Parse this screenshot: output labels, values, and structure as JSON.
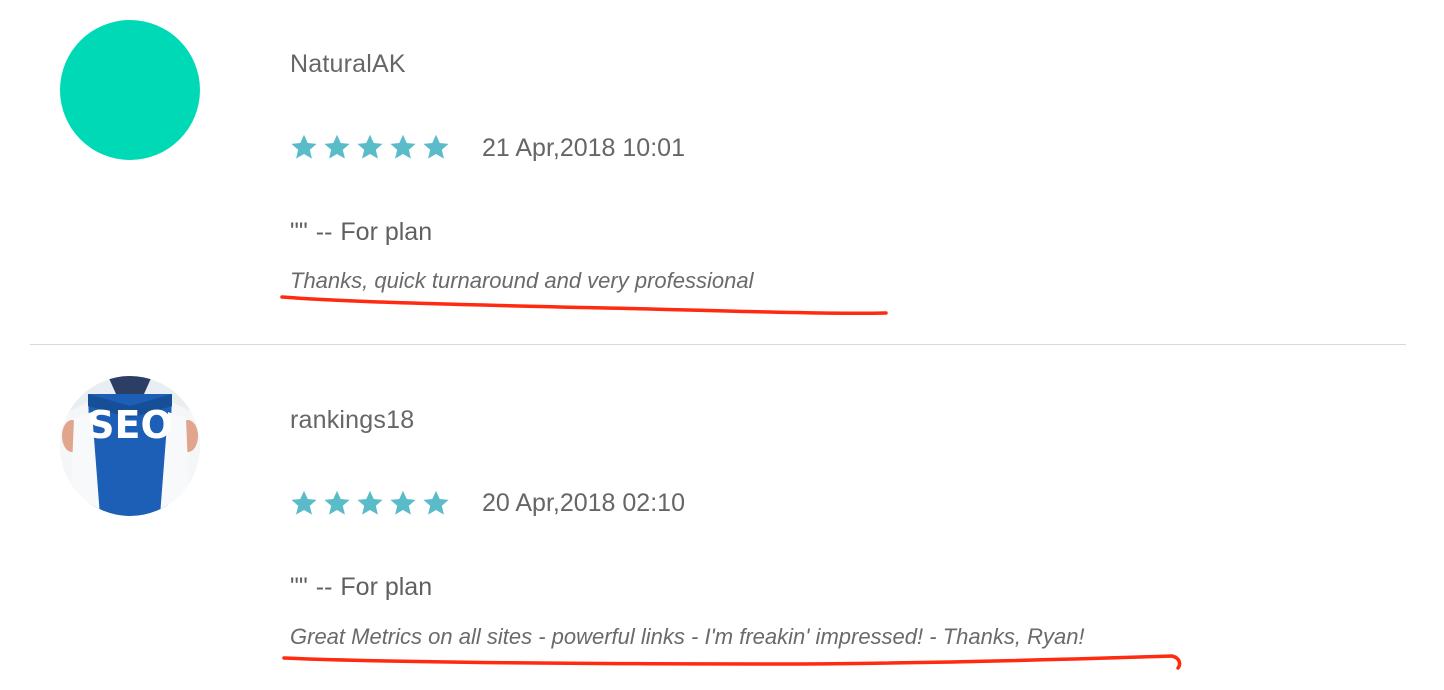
{
  "reviews": [
    {
      "username": "NaturalAK",
      "avatar": {
        "type": "solid",
        "color": "#00d9b5"
      },
      "rating": 5,
      "date": "21 Apr,2018 10:01",
      "plan_quote": "\"\"",
      "plan_separator": "--",
      "plan_label": "For plan",
      "comment": "Thanks, quick turnaround and very professional"
    },
    {
      "username": "rankings18",
      "avatar": {
        "type": "image",
        "text": "SEO"
      },
      "rating": 5,
      "date": "20 Apr,2018 02:10",
      "plan_quote": "\"\"",
      "plan_separator": "--",
      "plan_label": "For plan",
      "comment": "Great Metrics on all sites - powerful links - I'm freakin' impressed! - Thanks, Ryan!"
    }
  ],
  "colors": {
    "star": "#5bbcc9",
    "text": "#666666",
    "divider": "#d9d9d9",
    "annotation": "#ff2a10"
  }
}
